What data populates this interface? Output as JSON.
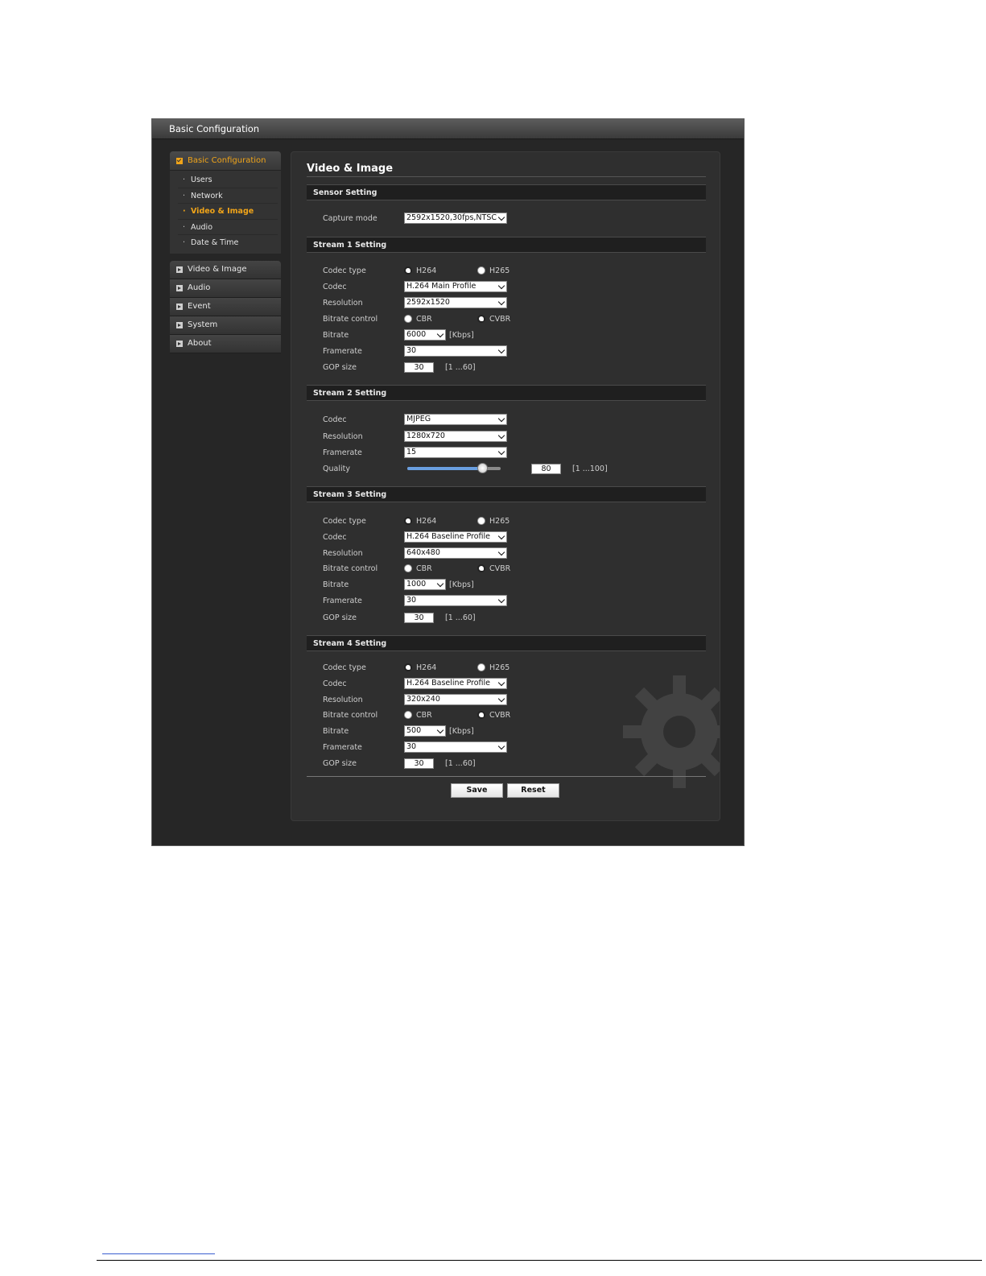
{
  "window": {
    "title": "Basic Configuration"
  },
  "sidebar": {
    "group_title": "Basic Configuration",
    "sub_items": [
      {
        "label": "Users"
      },
      {
        "label": "Network"
      },
      {
        "label": "Video & Image"
      },
      {
        "label": "Audio"
      },
      {
        "label": "Date & Time"
      }
    ],
    "active_sub_item": "Video & Image",
    "nav_items": [
      {
        "label": "Video & Image"
      },
      {
        "label": "Audio"
      },
      {
        "label": "Event"
      },
      {
        "label": "System"
      },
      {
        "label": "About"
      }
    ]
  },
  "page": {
    "title": "Video & Image"
  },
  "sensor": {
    "title": "Sensor Setting",
    "capture_mode_label": "Capture mode",
    "capture_mode_value": "2592x1520,30fps,NTSC"
  },
  "labels": {
    "codec_type": "Codec type",
    "codec": "Codec",
    "resolution": "Resolution",
    "bitrate_control": "Bitrate control",
    "bitrate": "Bitrate",
    "framerate": "Framerate",
    "gop_size": "GOP size",
    "quality": "Quality",
    "h264": "H264",
    "h265": "H265",
    "cbr": "CBR",
    "cvbr": "CVBR",
    "kbps": "[Kbps]",
    "gop_range": "[1 ...60]",
    "quality_range": "[1 ...100]"
  },
  "stream1": {
    "title": "Stream 1 Setting",
    "codec_type": "H264",
    "codec": "H.264 Main Profile",
    "resolution": "2592x1520",
    "bitrate_control": "CVBR",
    "bitrate": "6000",
    "framerate": "30",
    "gop_size": "30"
  },
  "stream2": {
    "title": "Stream 2 Setting",
    "codec": "MJPEG",
    "resolution": "1280x720",
    "framerate": "15",
    "quality": "80",
    "quality_fraction": 0.8
  },
  "stream3": {
    "title": "Stream 3 Setting",
    "codec_type": "H264",
    "codec": "H.264 Baseline Profile",
    "resolution": "640x480",
    "bitrate_control": "CVBR",
    "bitrate": "1000",
    "framerate": "30",
    "gop_size": "30"
  },
  "stream4": {
    "title": "Stream 4 Setting",
    "codec_type": "H264",
    "codec": "H.264 Baseline Profile",
    "resolution": "320x240",
    "bitrate_control": "CVBR",
    "bitrate": "500",
    "framerate": "30",
    "gop_size": "30"
  },
  "buttons": {
    "save": "Save",
    "reset": "Reset"
  },
  "colors": {
    "accent": "#f0a419",
    "slider_fill": "#6a9fe0",
    "background": "#262626"
  }
}
